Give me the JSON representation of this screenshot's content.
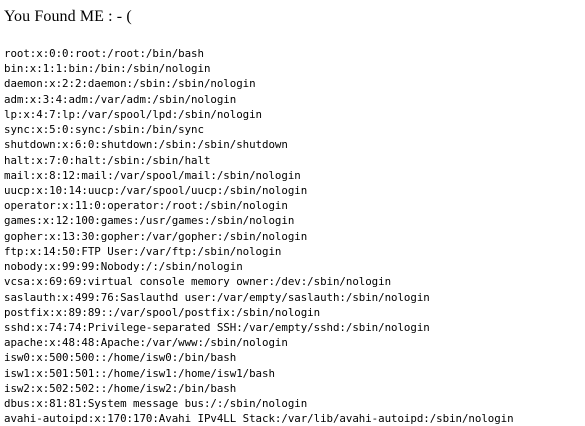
{
  "heading": "You Found ME : - (",
  "lines": [
    "root:x:0:0:root:/root:/bin/bash",
    "bin:x:1:1:bin:/bin:/sbin/nologin",
    "daemon:x:2:2:daemon:/sbin:/sbin/nologin",
    "adm:x:3:4:adm:/var/adm:/sbin/nologin",
    "lp:x:4:7:lp:/var/spool/lpd:/sbin/nologin",
    "sync:x:5:0:sync:/sbin:/bin/sync",
    "shutdown:x:6:0:shutdown:/sbin:/sbin/shutdown",
    "halt:x:7:0:halt:/sbin:/sbin/halt",
    "mail:x:8:12:mail:/var/spool/mail:/sbin/nologin",
    "uucp:x:10:14:uucp:/var/spool/uucp:/sbin/nologin",
    "operator:x:11:0:operator:/root:/sbin/nologin",
    "games:x:12:100:games:/usr/games:/sbin/nologin",
    "gopher:x:13:30:gopher:/var/gopher:/sbin/nologin",
    "ftp:x:14:50:FTP User:/var/ftp:/sbin/nologin",
    "nobody:x:99:99:Nobody:/:/sbin/nologin",
    "vcsa:x:69:69:virtual console memory owner:/dev:/sbin/nologin",
    "saslauth:x:499:76:Saslauthd user:/var/empty/saslauth:/sbin/nologin",
    "postfix:x:89:89::/var/spool/postfix:/sbin/nologin",
    "sshd:x:74:74:Privilege-separated SSH:/var/empty/sshd:/sbin/nologin",
    "apache:x:48:48:Apache:/var/www:/sbin/nologin",
    "isw0:x:500:500::/home/isw0:/bin/bash",
    "isw1:x:501:501::/home/isw1:/home/isw1/bash",
    "isw2:x:502:502::/home/isw2:/bin/bash",
    "dbus:x:81:81:System message bus:/:/sbin/nologin",
    "avahi-autoipd:x:170:170:Avahi IPv4LL Stack:/var/lib/avahi-autoipd:/sbin/nologin"
  ]
}
